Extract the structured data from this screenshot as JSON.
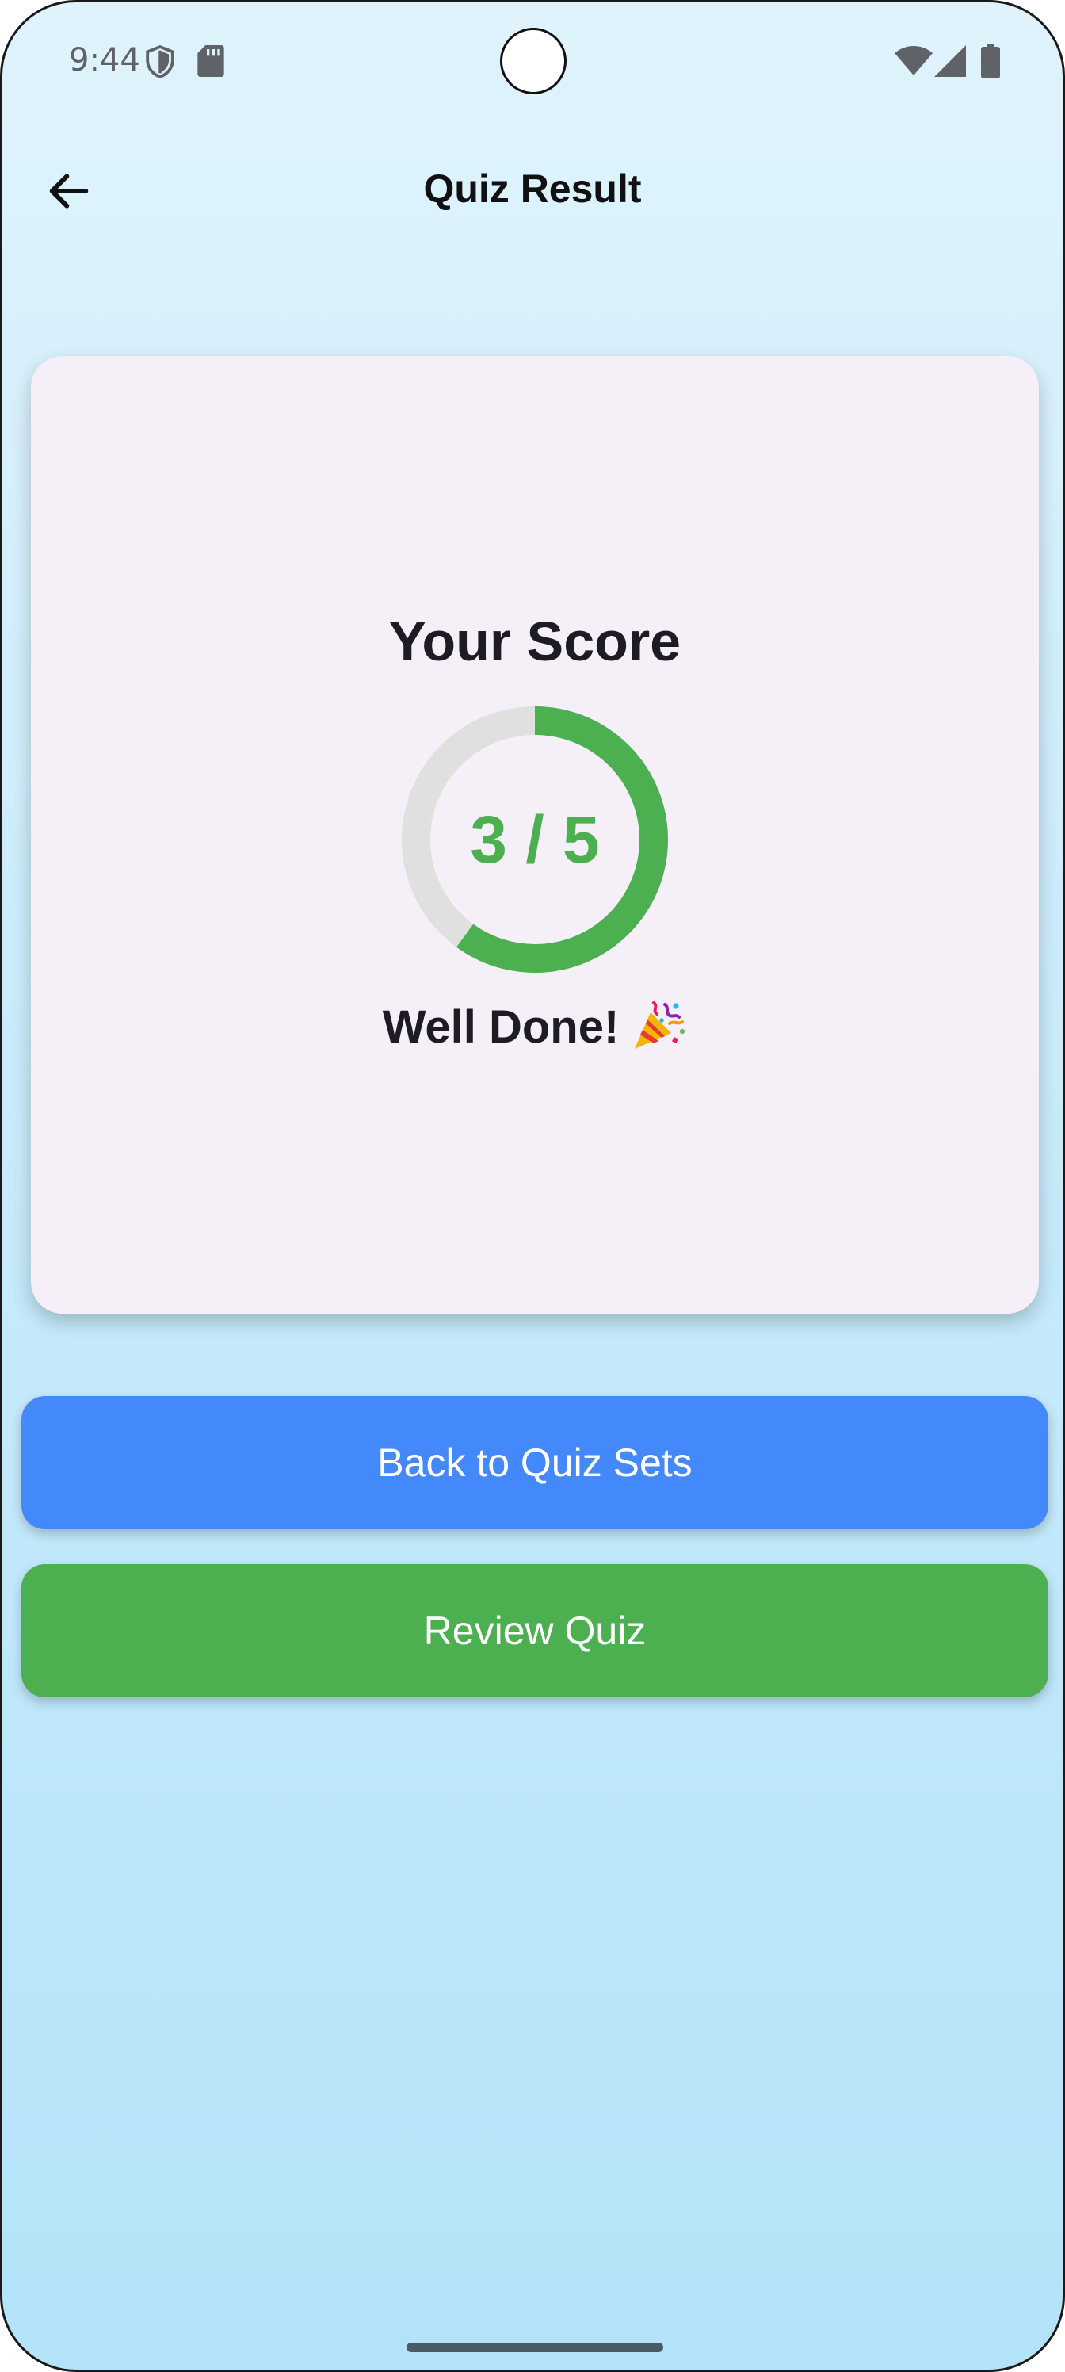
{
  "status_bar": {
    "time": "9:44",
    "icons": [
      "shield-icon",
      "sd-card-icon",
      "wifi-icon",
      "cellular-signal-icon",
      "battery-icon"
    ]
  },
  "app_bar": {
    "title": "Quiz Result",
    "back_icon": "arrow-back-icon"
  },
  "score_card": {
    "heading": "Your Score",
    "score_text": "3 / 5",
    "correct": 3,
    "total": 5,
    "progress_fraction": 0.6,
    "message": "Well Done!",
    "message_icon": "party-popper-icon"
  },
  "buttons": {
    "back_to_sets": "Back to Quiz Sets",
    "review": "Review Quiz"
  },
  "colors": {
    "primary_blue": "#4489fc",
    "success_green": "#4caf50",
    "ring_track": "#e0e0e0",
    "card_background": "#f5f0f8"
  }
}
